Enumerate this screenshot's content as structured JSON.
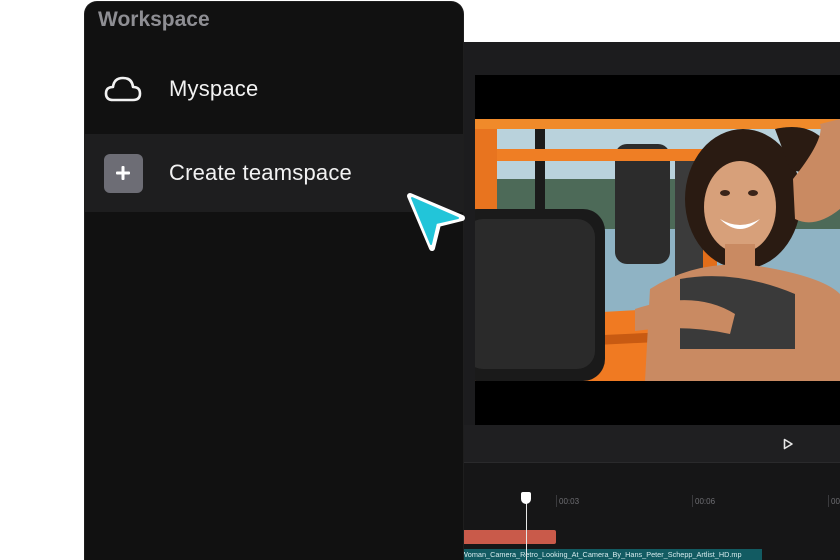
{
  "workspace": {
    "title": "Workspace",
    "items": [
      {
        "label": "Myspace",
        "icon": "cloud-icon"
      },
      {
        "label": "Create teamspace",
        "icon": "plus-icon"
      }
    ]
  },
  "timeline": {
    "ticks": [
      "00:03",
      "00:06",
      "00:0"
    ],
    "clip_name": "Woman_Camera_Retro_Looking_At_Camera_By_Hans_Peter_Schepp_Artlist_HD.mp"
  },
  "colors": {
    "accent": "#22c5d9",
    "audio_clip": "#c95a4a",
    "video_clip": "#125b62",
    "car": "#f07a22"
  },
  "icons": [
    "cloud-icon",
    "plus-icon",
    "play-icon",
    "pointer-cursor-icon"
  ]
}
